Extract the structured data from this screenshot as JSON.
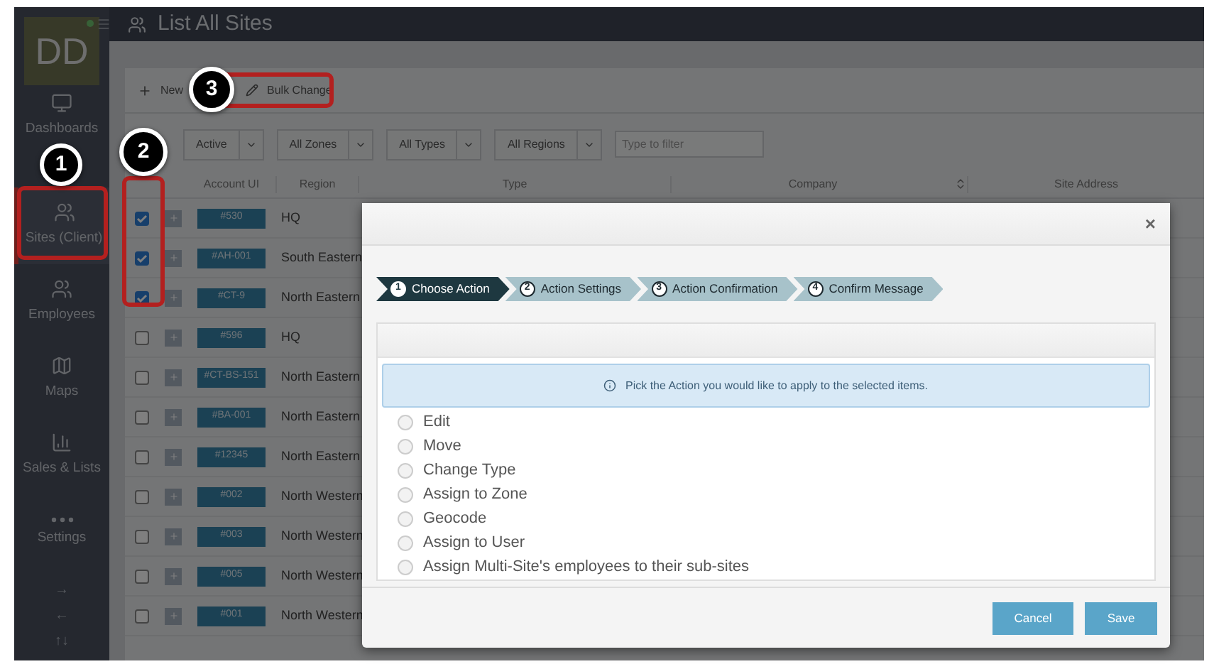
{
  "sidebar": {
    "avatar": "DD",
    "items": [
      {
        "kind": "monitor",
        "label": "Dashboards",
        "selected": false
      },
      {
        "kind": "users",
        "label": "Sites (Client)",
        "selected": true
      },
      {
        "kind": "users",
        "label": "Employees",
        "selected": false
      },
      {
        "kind": "map",
        "label": "Maps",
        "selected": false
      },
      {
        "kind": "chart",
        "label": "Sales & Lists",
        "selected": false
      },
      {
        "kind": "dots",
        "label": "Settings",
        "selected": false
      }
    ],
    "arrows": [
      "→",
      "←",
      "↑↓"
    ]
  },
  "page": {
    "title": "List All Sites"
  },
  "toolbar": [
    {
      "kind": "plus",
      "label": "New"
    },
    {
      "kind": "pencil",
      "label": "Bulk Change"
    }
  ],
  "filters": {
    "dropdowns": [
      "Active",
      "All Zones",
      "All Types",
      "All Regions"
    ],
    "search": {
      "placeholder": "Type to filter"
    }
  },
  "table": {
    "columns": [
      "Account UI",
      "Region",
      "Type",
      "Company",
      "Site Address"
    ],
    "rows": [
      {
        "checked": true,
        "account": "#530",
        "region": "HQ"
      },
      {
        "checked": true,
        "account": "#AH-001",
        "region": "South Eastern"
      },
      {
        "checked": true,
        "account": "#CT-9",
        "region": "North Eastern"
      },
      {
        "checked": false,
        "account": "#596",
        "region": "HQ"
      },
      {
        "checked": false,
        "account": "#CT-BS-151",
        "region": "North Eastern"
      },
      {
        "checked": false,
        "account": "#BA-001",
        "region": "North Eastern"
      },
      {
        "checked": false,
        "account": "#12345",
        "region": "North Eastern"
      },
      {
        "checked": false,
        "account": "#002",
        "region": "North Western"
      },
      {
        "checked": false,
        "account": "#003",
        "region": "North Western"
      },
      {
        "checked": false,
        "account": "#005",
        "region": "North Western"
      },
      {
        "checked": false,
        "account": "#001",
        "region": "North Western"
      }
    ]
  },
  "modal": {
    "close": "×",
    "steps": [
      {
        "number": "1",
        "label": "Choose Action",
        "selected": true
      },
      {
        "number": "2",
        "label": "Action Settings",
        "selected": false
      },
      {
        "number": "3",
        "label": "Action Confirmation",
        "selected": false
      },
      {
        "number": "4",
        "label": "Confirm Message",
        "selected": false
      }
    ],
    "info": "Pick the Action you would like to apply to the selected items.",
    "options": [
      {
        "label": "Edit",
        "selected": false
      },
      {
        "label": "Move",
        "selected": false
      },
      {
        "label": "Change Type",
        "selected": false
      },
      {
        "label": "Assign to Zone",
        "selected": false
      },
      {
        "label": "Geocode",
        "selected": false
      },
      {
        "label": "Assign to User",
        "selected": false
      },
      {
        "label": "Assign Multi-Site's employees to their sub-sites",
        "selected": false
      }
    ],
    "buttons": [
      "Cancel",
      "Save"
    ]
  },
  "callouts": [
    {
      "number": "1"
    },
    {
      "number": "2"
    },
    {
      "number": "3"
    }
  ]
}
